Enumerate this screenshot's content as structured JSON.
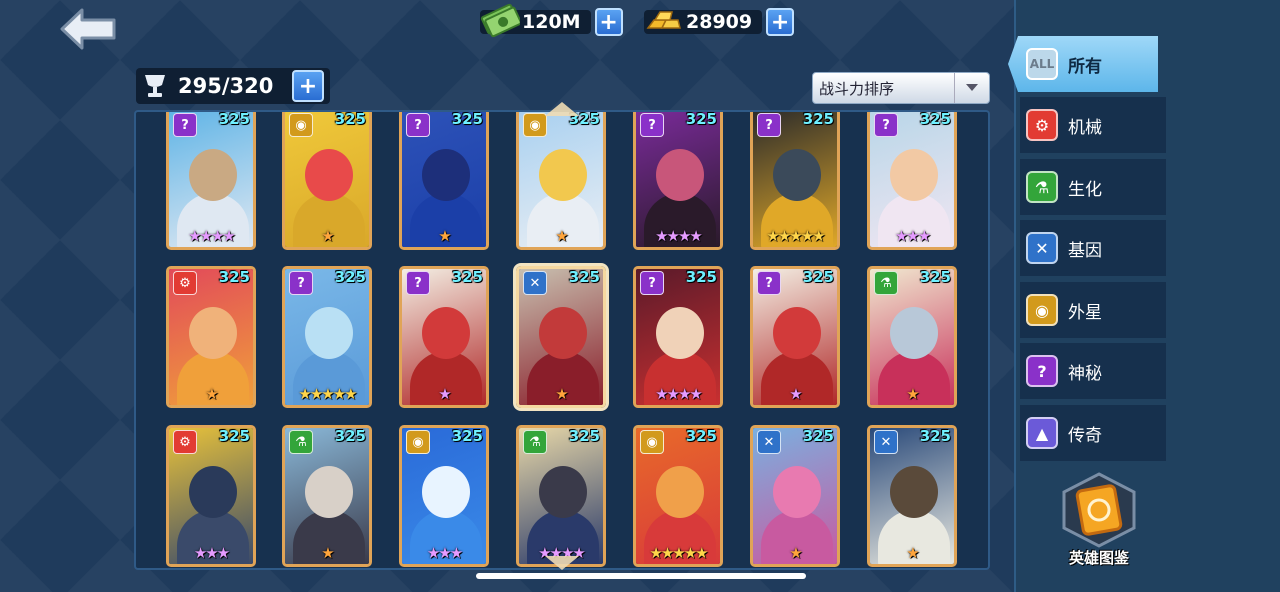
{
  "header": {
    "cash": {
      "value": "120M",
      "icon": "cash-icon"
    },
    "gold": {
      "value": "28909",
      "icon": "gold-bars-icon"
    },
    "plus_label": "+"
  },
  "capacity": {
    "value": "295/320",
    "icon": "trophy-cup-icon"
  },
  "sort": {
    "label": "战斗力排序"
  },
  "filters": [
    {
      "label": "所有",
      "icon_text": "ALL",
      "color": "#bcd8ea"
    },
    {
      "label": "机械",
      "icon_text": "⚙",
      "color": "#e23b33"
    },
    {
      "label": "生化",
      "icon_text": "⚗",
      "color": "#33a53a"
    },
    {
      "label": "基因",
      "icon_text": "✕",
      "color": "#2f72c9"
    },
    {
      "label": "外星",
      "icon_text": "◉",
      "color": "#d29a1c"
    },
    {
      "label": "神秘",
      "icon_text": "?",
      "color": "#8a31c9"
    },
    {
      "label": "传奇",
      "icon_text": "▲",
      "color": "#6b5ad8"
    }
  ],
  "codex": {
    "label": "英雄图鉴"
  },
  "heroes": [
    {
      "power": "325",
      "type": "?",
      "type_color": "#8a31c9",
      "stars": "★★★★",
      "star_color": "purple",
      "bg": "#5fb4e6",
      "face": "#c9a983",
      "body": "#dfe8f2"
    },
    {
      "power": "325",
      "type": "◉",
      "type_color": "#d29a1c",
      "stars": "★",
      "star_color": "orange",
      "bg": "#f0c93a",
      "face": "#e84a4a",
      "body": "#d9a82a"
    },
    {
      "power": "325",
      "type": "?",
      "type_color": "#8a31c9",
      "stars": "★",
      "star_color": "orange",
      "bg": "#2d52b8",
      "face": "#1d2f7a",
      "body": "#1b3fa8"
    },
    {
      "power": "325",
      "type": "◉",
      "type_color": "#d29a1c",
      "stars": "★",
      "star_color": "orange",
      "bg": "#a8d0f0",
      "face": "#f2c84e",
      "body": "#e9eef4"
    },
    {
      "power": "325",
      "type": "?",
      "type_color": "#8a31c9",
      "stars": "★★★★",
      "star_color": "purple",
      "bg": "#7a2b9a",
      "face": "#c8567a",
      "body": "#2a1a2a"
    },
    {
      "power": "325",
      "type": "?",
      "type_color": "#8a31c9",
      "stars": "★★★★★",
      "star_color": "gold",
      "bg": "#2b2b2b",
      "face": "#3b4a5a",
      "body": "#e0a828"
    },
    {
      "power": "325",
      "type": "?",
      "type_color": "#8a31c9",
      "stars": "★★★",
      "star_color": "purple",
      "bg": "#b8d6e8",
      "face": "#f2c9a4",
      "body": "#f0e6f2"
    },
    {
      "power": "325",
      "type": "⚙",
      "type_color": "#e23b33",
      "stars": "★",
      "star_color": "orange",
      "bg": "#e24a5a",
      "face": "#f0b27a",
      "body": "#f0a03a"
    },
    {
      "power": "325",
      "type": "?",
      "type_color": "#8a31c9",
      "stars": "★★★★★",
      "star_color": "gold",
      "bg": "#7ab8e8",
      "face": "#b9e0f4",
      "body": "#5a9ad8"
    },
    {
      "power": "325",
      "type": "?",
      "type_color": "#8a31c9",
      "stars": "★",
      "star_color": "purple",
      "bg": "#f3efe4",
      "face": "#d23a3a",
      "body": "#b02828"
    },
    {
      "power": "325",
      "type": "✕",
      "type_color": "#2f72c9",
      "stars": "★",
      "star_color": "orange",
      "bg": "#c8c0b0",
      "face": "#c23a3a",
      "body": "#8a1e2a"
    },
    {
      "power": "325",
      "type": "?",
      "type_color": "#8a31c9",
      "stars": "★★★★",
      "star_color": "purple",
      "bg": "#5a1a2a",
      "face": "#f0d2b8",
      "body": "#c83030"
    },
    {
      "power": "325",
      "type": "?",
      "type_color": "#8a31c9",
      "stars": "★",
      "star_color": "purple",
      "bg": "#f3efe4",
      "face": "#d23a3a",
      "body": "#b02828"
    },
    {
      "power": "325",
      "type": "⚗",
      "type_color": "#33a53a",
      "stars": "★",
      "star_color": "orange",
      "bg": "#f0e8d0",
      "face": "#b8c8d8",
      "body": "#c8305a"
    },
    {
      "power": "325",
      "type": "⚙",
      "type_color": "#e23b33",
      "stars": "★★★",
      "star_color": "purple",
      "bg": "#e8c23a",
      "face": "#2a3a5a",
      "body": "#3a4a6a"
    },
    {
      "power": "325",
      "type": "⚗",
      "type_color": "#33a53a",
      "stars": "★",
      "star_color": "orange",
      "bg": "#8ab8d8",
      "face": "#d8d0c8",
      "body": "#3a3a4a"
    },
    {
      "power": "325",
      "type": "◉",
      "type_color": "#d29a1c",
      "stars": "★★★",
      "star_color": "purple",
      "bg": "#2a6ad8",
      "face": "#e8f4ff",
      "body": "#3a8ae8"
    },
    {
      "power": "325",
      "type": "⚗",
      "type_color": "#33a53a",
      "stars": "★★★★",
      "star_color": "purple",
      "bg": "#e8d8a8",
      "face": "#3a3a4a",
      "body": "#2a3a6a"
    },
    {
      "power": "325",
      "type": "◉",
      "type_color": "#d29a1c",
      "stars": "★★★★★",
      "star_color": "gold",
      "bg": "#e86a2a",
      "face": "#f0a04a",
      "body": "#d83a3a"
    },
    {
      "power": "325",
      "type": "✕",
      "type_color": "#2f72c9",
      "stars": "★",
      "star_color": "orange",
      "bg": "#7ab0e0",
      "face": "#e87ab0",
      "body": "#c85aa0"
    },
    {
      "power": "325",
      "type": "✕",
      "type_color": "#2f72c9",
      "stars": "★",
      "star_color": "orange",
      "bg": "#2a4a7a",
      "face": "#5a4a3a",
      "body": "#e8e8e0"
    }
  ]
}
